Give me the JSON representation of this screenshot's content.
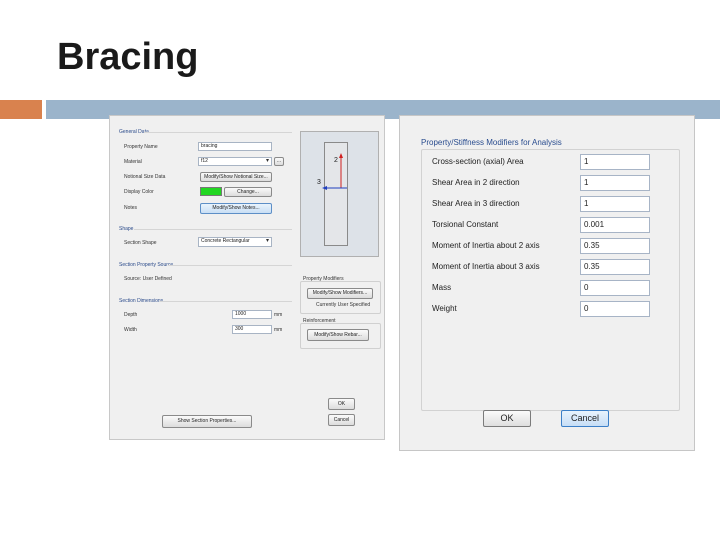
{
  "slide": {
    "title": "Bracing"
  },
  "section_dialog": {
    "general_data": {
      "heading": "General Data",
      "property_name_label": "Property Name",
      "property_name_value": "bracing",
      "material_label": "Material",
      "material_value": "f12",
      "notional_label": "Notional Size Data",
      "notional_button": "Modify/Show Notional Size...",
      "display_color_label": "Display Color",
      "display_color": "#22d622",
      "change_button": "Change...",
      "notes_label": "Notes",
      "notes_button": "Modify/Show Notes..."
    },
    "preview": {
      "axis2": "2",
      "axis3": "3"
    },
    "shape": {
      "heading": "Shape",
      "label": "Section Shape",
      "value": "Concrete Rectangular"
    },
    "source": {
      "heading": "Section Property Source",
      "text": "Source: User Defined"
    },
    "property_modifiers": {
      "heading": "Property Modifiers",
      "button": "Modify/Show Modifiers...",
      "status": "Currently User Specified"
    },
    "reinforcement": {
      "heading": "Reinforcement",
      "button": "Modify/Show Rebar..."
    },
    "dimensions": {
      "heading": "Section Dimensions",
      "depth_label": "Depth",
      "depth_value": "1000",
      "depth_unit": "mm",
      "width_label": "Width",
      "width_value": "300",
      "width_unit": "mm"
    },
    "show_props_button": "Show Section Properties...",
    "ok_button": "OK",
    "cancel_button": "Cancel"
  },
  "modifiers_dialog": {
    "title": "Property/Stiffness Modifiers for Analysis",
    "rows": [
      {
        "label": "Cross-section (axial) Area",
        "value": "1"
      },
      {
        "label": "Shear Area in 2 direction",
        "value": "1"
      },
      {
        "label": "Shear Area in 3 direction",
        "value": "1"
      },
      {
        "label": "Torsional Constant",
        "value": "0.001"
      },
      {
        "label": "Moment of Inertia about 2 axis",
        "value": "0.35"
      },
      {
        "label": "Moment of Inertia about 3 axis",
        "value": "0.35"
      },
      {
        "label": "Mass",
        "value": "0"
      },
      {
        "label": "Weight",
        "value": "0"
      }
    ],
    "ok_button": "OK",
    "cancel_button": "Cancel"
  },
  "colors": {
    "accent": "#d9824e",
    "rule": "#9bb4cb"
  }
}
